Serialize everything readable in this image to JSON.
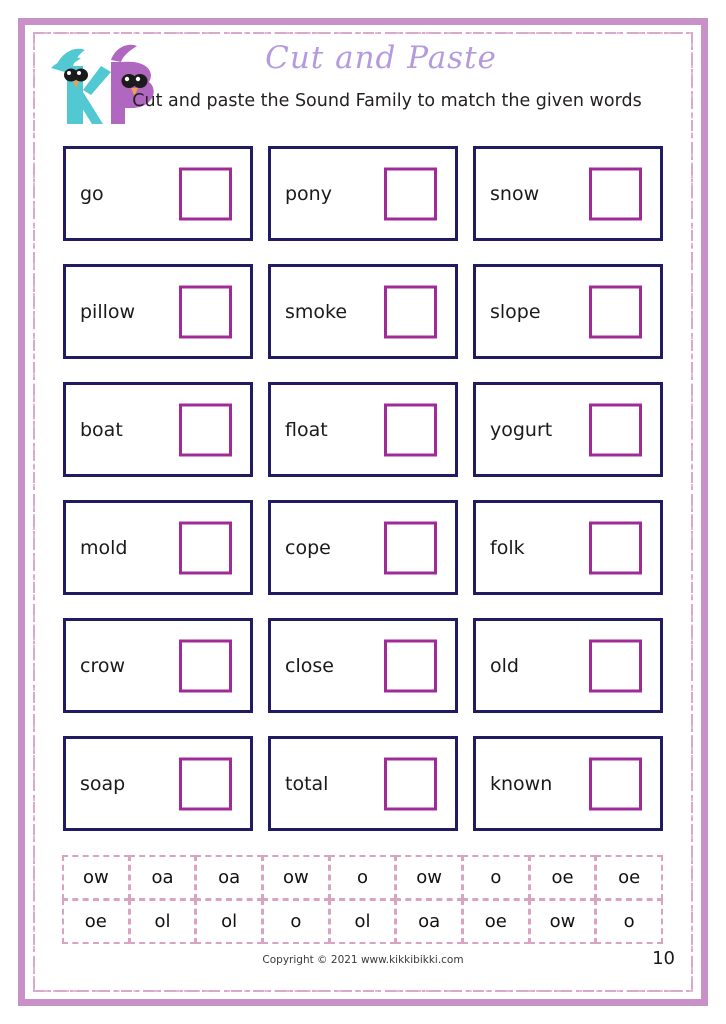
{
  "page": {
    "title": "Cut and Paste",
    "subtitle": "Cut and paste the Sound Family to match the given words",
    "page_number": "10",
    "copyright": "Copyright © 2021 www.kikkibikki.com"
  },
  "logo": {
    "letter_k": "K",
    "letter_b": "B",
    "k_color": "#52c8d2",
    "b_color": "#b067c0"
  },
  "colors": {
    "outer_frame": "#c891c8",
    "inner_frame": "#d9a9cb",
    "title": "#b49adf",
    "card_border": "#201b63",
    "answer_box": "#a02b96",
    "tile_border": "#d9a3c2",
    "text": "#1a1a1a"
  },
  "cards": [
    {
      "word": "go"
    },
    {
      "word": "pony"
    },
    {
      "word": "snow"
    },
    {
      "word": "pillow"
    },
    {
      "word": "smoke"
    },
    {
      "word": "slope"
    },
    {
      "word": "boat"
    },
    {
      "word": "float"
    },
    {
      "word": "yogurt"
    },
    {
      "word": "mold"
    },
    {
      "word": "cope"
    },
    {
      "word": "folk"
    },
    {
      "word": "crow"
    },
    {
      "word": "close"
    },
    {
      "word": "old"
    },
    {
      "word": "soap"
    },
    {
      "word": "total"
    },
    {
      "word": "known"
    }
  ],
  "tiles": [
    {
      "label": "ow"
    },
    {
      "label": "oa"
    },
    {
      "label": "oa"
    },
    {
      "label": "ow"
    },
    {
      "label": "o"
    },
    {
      "label": "ow"
    },
    {
      "label": "o"
    },
    {
      "label": "oe"
    },
    {
      "label": "oe"
    },
    {
      "label": "oe"
    },
    {
      "label": "ol"
    },
    {
      "label": "ol"
    },
    {
      "label": "o"
    },
    {
      "label": "ol"
    },
    {
      "label": "oa"
    },
    {
      "label": "oe"
    },
    {
      "label": "ow"
    },
    {
      "label": "o"
    }
  ]
}
